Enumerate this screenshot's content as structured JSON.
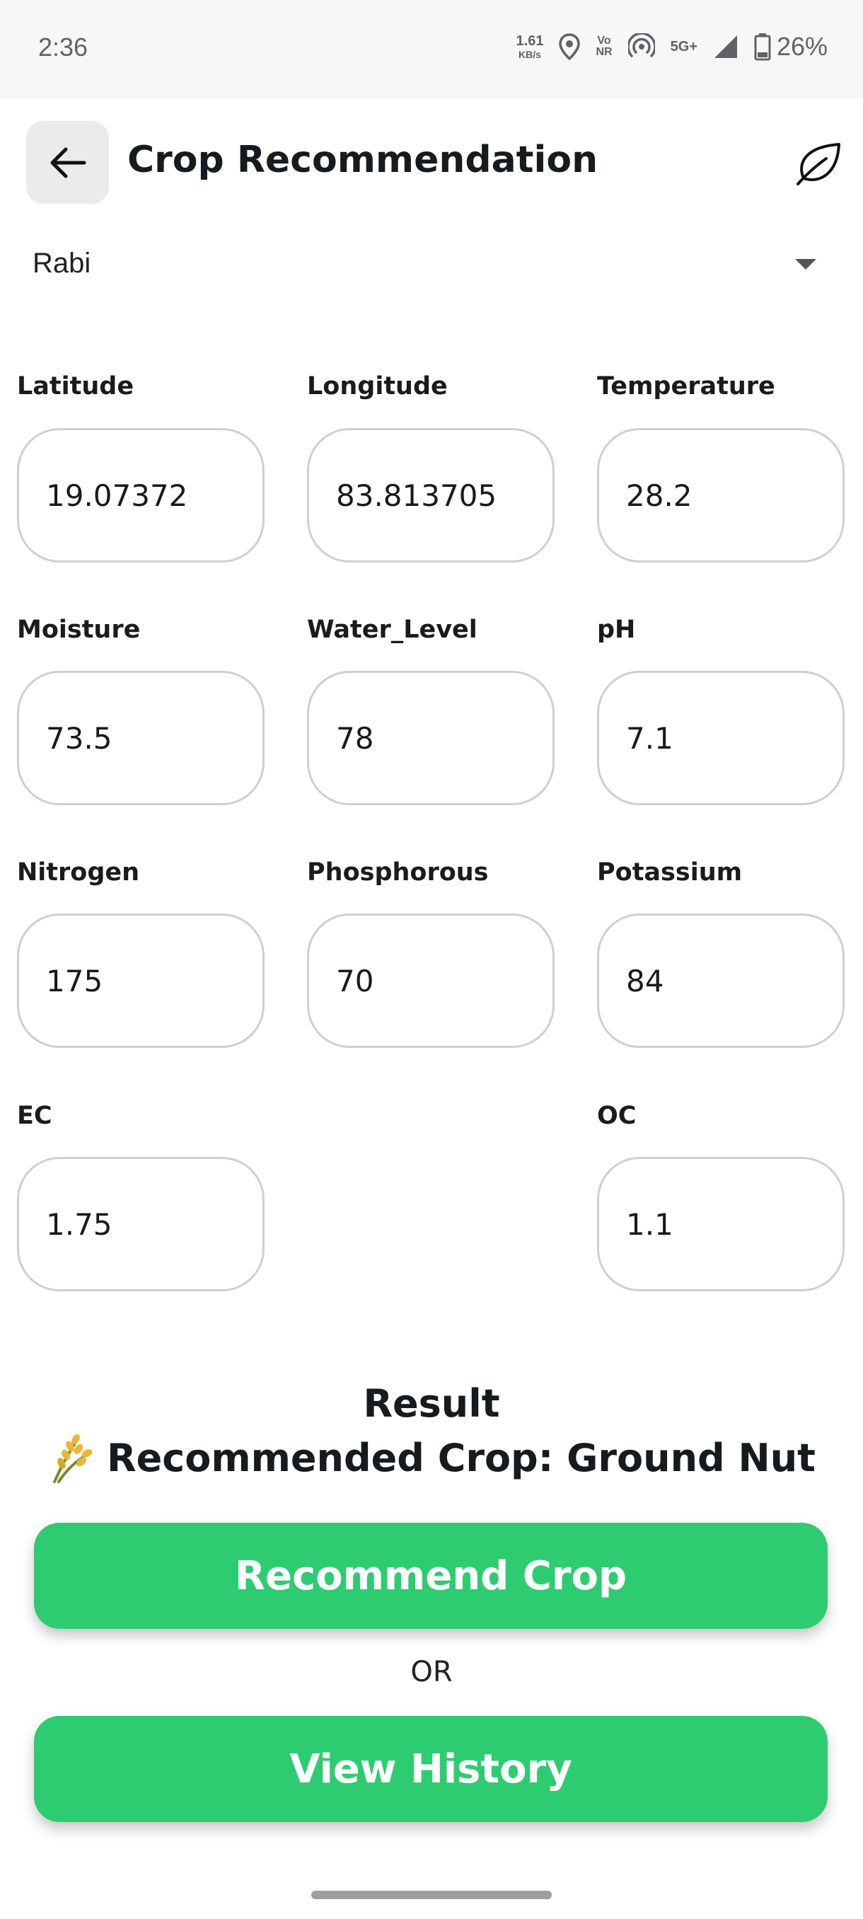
{
  "status_bar": {
    "time": "2:36",
    "net_speed_value": "1.61",
    "net_speed_unit": "KB/s",
    "volte_top": "Vo",
    "volte_bottom": "NR",
    "network_type": "5G+",
    "battery": "26%",
    "icons": [
      "location-icon",
      "hotspot-icon",
      "signal-icon",
      "battery-icon"
    ]
  },
  "app_bar": {
    "title": "Crop Recommendation",
    "icons": [
      "back-arrow-icon",
      "leaf-icon"
    ]
  },
  "season": {
    "selected": "Rabi"
  },
  "fields": {
    "latitude": {
      "label": "Latitude",
      "value": "19.07372"
    },
    "longitude": {
      "label": "Longitude",
      "value": "83.813705"
    },
    "temperature": {
      "label": "Temperature",
      "value": "28.2"
    },
    "moisture": {
      "label": "Moisture",
      "value": "73.5"
    },
    "water_level": {
      "label": "Water_Level",
      "value": "78"
    },
    "ph": {
      "label": "pH",
      "value": "7.1"
    },
    "nitrogen": {
      "label": "Nitrogen",
      "value": "175"
    },
    "phosphorous": {
      "label": "Phosphorous",
      "value": "70"
    },
    "potassium": {
      "label": "Potassium",
      "value": "84"
    },
    "ec": {
      "label": "EC",
      "value": "1.75"
    },
    "oc": {
      "label": "OC",
      "value": "1.1"
    }
  },
  "result": {
    "title": "Result",
    "text": "Recommended Crop: Ground Nut",
    "icon": "rice-icon"
  },
  "actions": {
    "recommend_label": "Recommend Crop",
    "or_label": "OR",
    "history_label": "View History"
  },
  "colors": {
    "accent_green": "#2ecc71",
    "input_border": "#cfcfcf",
    "back_button_bg": "#ebebeb"
  }
}
